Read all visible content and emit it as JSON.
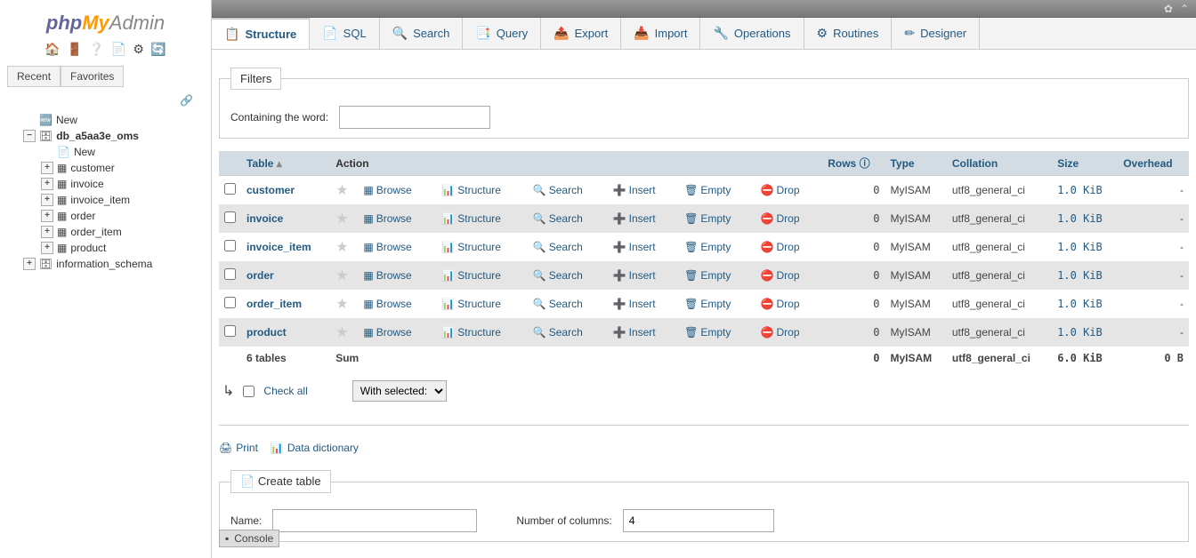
{
  "logo": {
    "php": "php",
    "my": "My",
    "admin": "Admin"
  },
  "sidebar_buttons": {
    "recent": "Recent",
    "favorites": "Favorites"
  },
  "tree": {
    "new": "New",
    "active_db": "db_a5aa3e_oms",
    "db_new": "New",
    "tables": [
      "customer",
      "invoice",
      "invoice_item",
      "order",
      "order_item",
      "product"
    ],
    "info_schema": "information_schema"
  },
  "tabs": [
    {
      "icon": "📋",
      "label": "Structure",
      "active": true
    },
    {
      "icon": "📄",
      "label": "SQL"
    },
    {
      "icon": "🔍",
      "label": "Search"
    },
    {
      "icon": "📑",
      "label": "Query"
    },
    {
      "icon": "📤",
      "label": "Export"
    },
    {
      "icon": "📥",
      "label": "Import"
    },
    {
      "icon": "🔧",
      "label": "Operations"
    },
    {
      "icon": "⚙",
      "label": "Routines"
    },
    {
      "icon": "✏",
      "label": "Designer"
    }
  ],
  "filters": {
    "legend": "Filters",
    "label": "Containing the word:"
  },
  "columns": {
    "table": "Table",
    "action": "Action",
    "rows": "Rows",
    "type": "Type",
    "collation": "Collation",
    "size": "Size",
    "overhead": "Overhead"
  },
  "actions": {
    "browse": "Browse",
    "structure": "Structure",
    "search": "Search",
    "insert": "Insert",
    "empty": "Empty",
    "drop": "Drop"
  },
  "rows": [
    {
      "name": "customer",
      "rows": "0",
      "type": "MyISAM",
      "collation": "utf8_general_ci",
      "size": "1.0 KiB",
      "overhead": "-"
    },
    {
      "name": "invoice",
      "rows": "0",
      "type": "MyISAM",
      "collation": "utf8_general_ci",
      "size": "1.0 KiB",
      "overhead": "-"
    },
    {
      "name": "invoice_item",
      "rows": "0",
      "type": "MyISAM",
      "collation": "utf8_general_ci",
      "size": "1.0 KiB",
      "overhead": "-"
    },
    {
      "name": "order",
      "rows": "0",
      "type": "MyISAM",
      "collation": "utf8_general_ci",
      "size": "1.0 KiB",
      "overhead": "-"
    },
    {
      "name": "order_item",
      "rows": "0",
      "type": "MyISAM",
      "collation": "utf8_general_ci",
      "size": "1.0 KiB",
      "overhead": "-"
    },
    {
      "name": "product",
      "rows": "0",
      "type": "MyISAM",
      "collation": "utf8_general_ci",
      "size": "1.0 KiB",
      "overhead": "-"
    }
  ],
  "sum": {
    "label": "6 tables",
    "sum": "Sum",
    "rows": "0",
    "type": "MyISAM",
    "collation": "utf8_general_ci",
    "size": "6.0 KiB",
    "overhead": "0 B"
  },
  "checkall": {
    "label": "Check all",
    "select": "With selected:"
  },
  "util": {
    "print": "Print",
    "dict": "Data dictionary"
  },
  "create": {
    "legend": "Create table",
    "name": "Name:",
    "cols": "Number of columns:",
    "cols_value": "4"
  },
  "console": "Console"
}
